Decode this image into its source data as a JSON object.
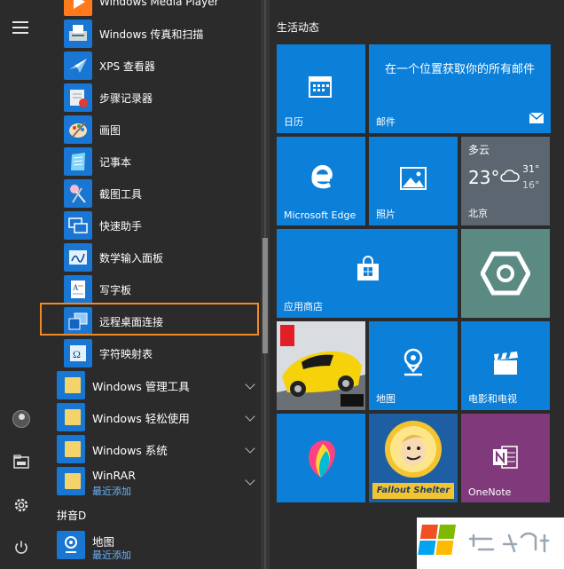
{
  "rail": {
    "menu_icon": "hamburger-icon",
    "user_icon": "user-icon",
    "explorer_icon": "file-explorer-icon",
    "settings_icon": "gear-icon",
    "power_icon": "power-icon"
  },
  "apps": [
    {
      "label": "Windows Media Player",
      "icon": "media-player-icon"
    },
    {
      "label": "Windows 传真和扫描",
      "icon": "fax-scan-icon"
    },
    {
      "label": "XPS 查看器",
      "icon": "xps-viewer-icon"
    },
    {
      "label": "步骤记录器",
      "icon": "steps-recorder-icon"
    },
    {
      "label": "画图",
      "icon": "paint-icon"
    },
    {
      "label": "记事本",
      "icon": "notepad-icon"
    },
    {
      "label": "截图工具",
      "icon": "snipping-tool-icon"
    },
    {
      "label": "快速助手",
      "icon": "quick-assist-icon"
    },
    {
      "label": "数学输入面板",
      "icon": "math-input-icon"
    },
    {
      "label": "写字板",
      "icon": "wordpad-icon"
    },
    {
      "label": "远程桌面连接",
      "icon": "remote-desktop-icon"
    },
    {
      "label": "字符映射表",
      "icon": "character-map-icon"
    }
  ],
  "folders": [
    {
      "label": "Windows 管理工具"
    },
    {
      "label": "Windows 轻松使用"
    },
    {
      "label": "Windows 系统"
    },
    {
      "label": "WinRAR",
      "sub": "最近添加"
    }
  ],
  "letter_header": "拼音D",
  "map_app": {
    "label": "地图",
    "sub": "最近添加"
  },
  "tiles_group": "生活动态",
  "tiles": {
    "calendar": "日历",
    "mail_promo": "在一个位置获取你的所有邮件",
    "mail": "邮件",
    "edge": "Microsoft Edge",
    "photos": "照片",
    "store": "应用商店",
    "maps": "地图",
    "movies": "电影和电视",
    "onenote": "OneNote",
    "fallout_logo": "Fallout Shelter"
  },
  "weather": {
    "condition": "多云",
    "temp": "23°",
    "high": "31°",
    "low": "16°",
    "city": "北京"
  },
  "colors": {
    "tile_blue": "#0c7fd8",
    "highlight": "#f08a24",
    "background": "#2b2b2b"
  }
}
